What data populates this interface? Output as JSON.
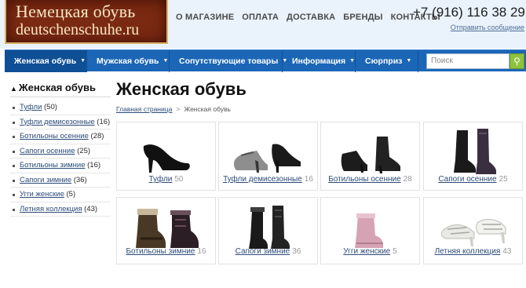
{
  "header": {
    "logo_line1": "Немецкая обувь",
    "logo_line2": "deutschenschuhe.ru",
    "top_links": [
      "О МАГАЗИНЕ",
      "ОПЛАТА",
      "ДОСТАВКА",
      "БРЕНДЫ",
      "КОНТАКТЫ"
    ],
    "phone": "+7 (916) 116 38 29",
    "send_message": "Отправить сообщение"
  },
  "mainnav": {
    "items": [
      {
        "label": "Женская обувь",
        "active": true
      },
      {
        "label": "Мужская обувь"
      },
      {
        "label": "Сопутствующие товары"
      },
      {
        "label": "Информация"
      },
      {
        "label": "Сюрприз"
      }
    ],
    "search_placeholder": "Поиск"
  },
  "sidebar": {
    "title": "Женская обувь",
    "items": [
      {
        "label": "Туфли",
        "count": "(50)"
      },
      {
        "label": "Туфли демисезонные",
        "count": "(16)"
      },
      {
        "label": "Ботильоны осенние",
        "count": "(28)"
      },
      {
        "label": "Сапоги осенние",
        "count": "(25)"
      },
      {
        "label": "Ботильоны зимние",
        "count": "(16)"
      },
      {
        "label": "Сапоги зимние",
        "count": "(36)"
      },
      {
        "label": "Угги женские",
        "count": "(5)"
      },
      {
        "label": "Летняя коллекция",
        "count": "(43)"
      }
    ]
  },
  "content": {
    "title": "Женская обувь",
    "breadcrumb": [
      "Главная страница",
      "Женская обувь"
    ],
    "categories": [
      {
        "name": "Туфли",
        "count": "50",
        "icon": "pump-shoe-icon"
      },
      {
        "name": "Туфли демисезонные",
        "count": "16",
        "icon": "demi-season-shoes-icon"
      },
      {
        "name": "Ботильоны осенние",
        "count": "28",
        "icon": "ankle-boots-icon"
      },
      {
        "name": "Сапоги осенние",
        "count": "25",
        "icon": "tall-boots-icon"
      },
      {
        "name": "Ботильоны зимние",
        "count": "16",
        "icon": "winter-ankle-boots-icon"
      },
      {
        "name": "Сапоги зимние",
        "count": "36",
        "icon": "winter-boots-icon"
      },
      {
        "name": "Угги женские",
        "count": "5",
        "icon": "ugg-boots-icon"
      },
      {
        "name": "Летняя коллекция",
        "count": "43",
        "icon": "summer-sandals-icon"
      }
    ]
  }
}
